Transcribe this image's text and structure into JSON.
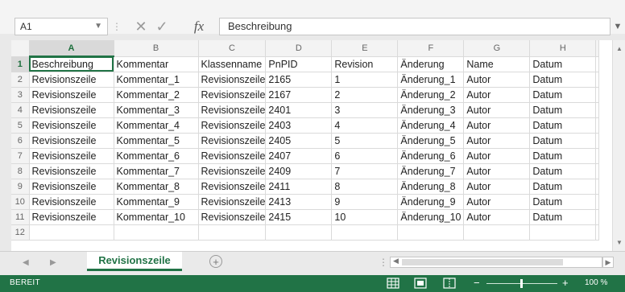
{
  "name_box": {
    "value": "A1"
  },
  "formula_bar": {
    "value": "Beschreibung",
    "fx_label": "fx"
  },
  "columns": [
    "A",
    "B",
    "C",
    "D",
    "E",
    "F",
    "G",
    "H"
  ],
  "rows": [
    {
      "num": "1",
      "cells": [
        "Beschreibung",
        "Kommentar",
        "Klassenname",
        "PnPID",
        "Revision",
        "Änderung",
        "Name",
        "Datum"
      ]
    },
    {
      "num": "2",
      "cells": [
        "Revisionszeile",
        "Kommentar_1",
        "Revisionszeile",
        "2165",
        "1",
        "Änderung_1",
        "Autor",
        "Datum"
      ]
    },
    {
      "num": "3",
      "cells": [
        "Revisionszeile",
        "Kommentar_2",
        "Revisionszeile",
        "2167",
        "2",
        "Änderung_2",
        "Autor",
        "Datum"
      ]
    },
    {
      "num": "4",
      "cells": [
        "Revisionszeile",
        "Kommentar_3",
        "Revisionszeile",
        "2401",
        "3",
        "Änderung_3",
        "Autor",
        "Datum"
      ]
    },
    {
      "num": "5",
      "cells": [
        "Revisionszeile",
        "Kommentar_4",
        "Revisionszeile",
        "2403",
        "4",
        "Änderung_4",
        "Autor",
        "Datum"
      ]
    },
    {
      "num": "6",
      "cells": [
        "Revisionszeile",
        "Kommentar_5",
        "Revisionszeile",
        "2405",
        "5",
        "Änderung_5",
        "Autor",
        "Datum"
      ]
    },
    {
      "num": "7",
      "cells": [
        "Revisionszeile",
        "Kommentar_6",
        "Revisionszeile",
        "2407",
        "6",
        "Änderung_6",
        "Autor",
        "Datum"
      ]
    },
    {
      "num": "8",
      "cells": [
        "Revisionszeile",
        "Kommentar_7",
        "Revisionszeile",
        "2409",
        "7",
        "Änderung_7",
        "Autor",
        "Datum"
      ]
    },
    {
      "num": "9",
      "cells": [
        "Revisionszeile",
        "Kommentar_8",
        "Revisionszeile",
        "2411",
        "8",
        "Änderung_8",
        "Autor",
        "Datum"
      ]
    },
    {
      "num": "10",
      "cells": [
        "Revisionszeile",
        "Kommentar_9",
        "Revisionszeile",
        "2413",
        "9",
        "Änderung_9",
        "Autor",
        "Datum"
      ]
    },
    {
      "num": "11",
      "cells": [
        "Revisionszeile",
        "Kommentar_10",
        "Revisionszeile",
        "2415",
        "10",
        "Änderung_10",
        "Autor",
        "Datum"
      ]
    },
    {
      "num": "12",
      "cells": [
        "",
        "",
        "",
        "",
        "",
        "",
        "",
        ""
      ]
    }
  ],
  "sheet_tab": {
    "label": "Revisionszeile"
  },
  "status": {
    "text": "BEREIT",
    "zoom": "100 %"
  },
  "colors": {
    "accent": "#217346",
    "header_bg": "#f3f3f3"
  },
  "icons": {
    "cancel": "close-icon",
    "enter": "check-icon",
    "add_sheet": "plus-icon",
    "normal_view": "normal-view-icon",
    "page_layout": "page-layout-icon",
    "page_break": "page-break-icon"
  }
}
